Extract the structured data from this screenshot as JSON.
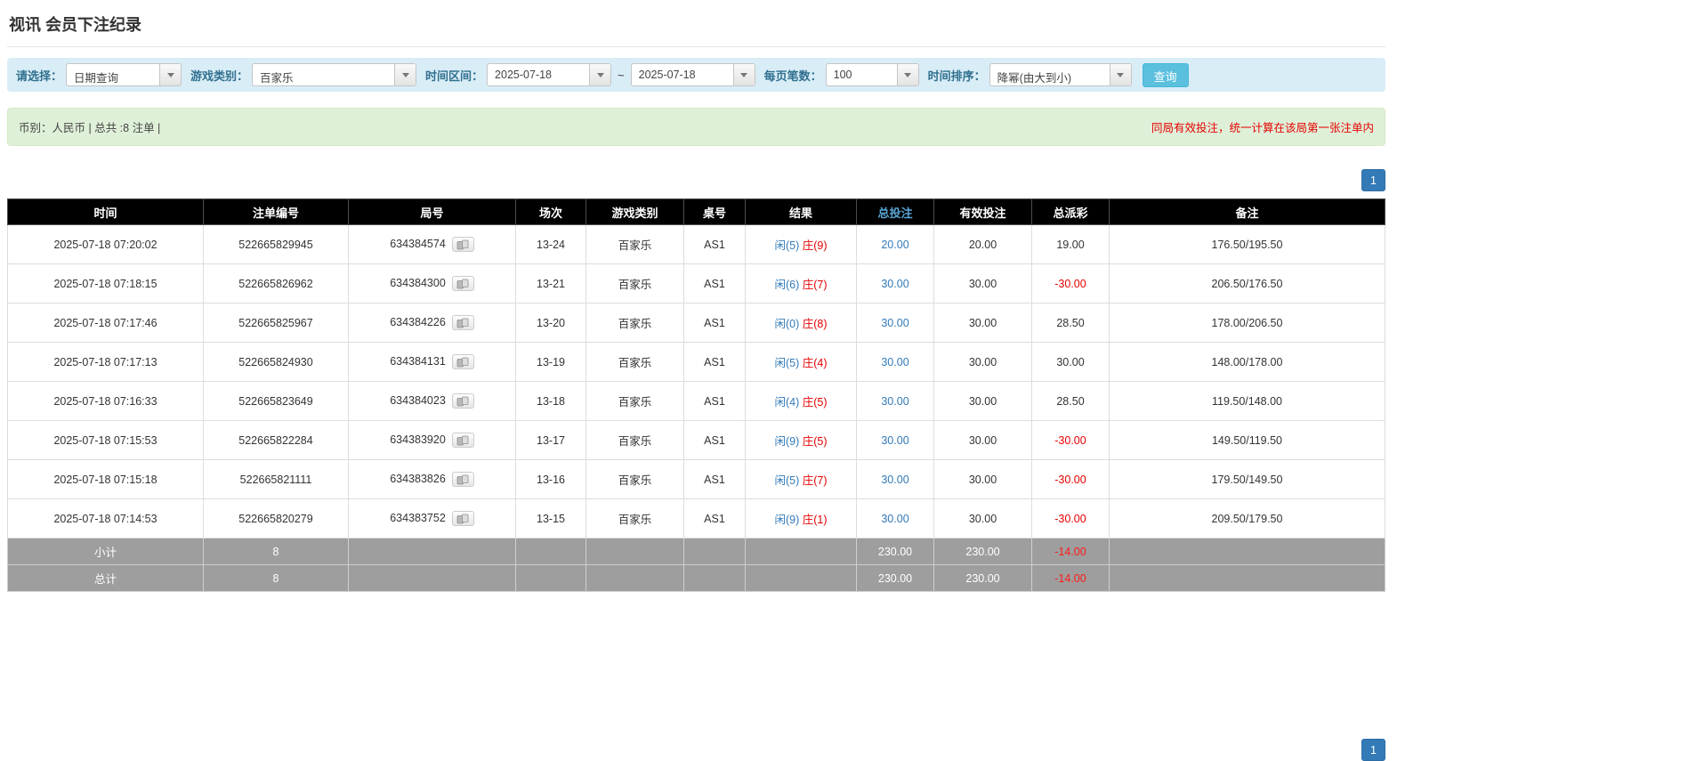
{
  "page": {
    "title": "视讯 会员下注纪录"
  },
  "filters": {
    "select_label": "请选择：",
    "select_value": "日期查询",
    "game_type_label": "游戏类别：",
    "game_type_value": "百家乐",
    "time_range_label": "时间区间：",
    "date_from": "2025-07-18",
    "date_separator": "~",
    "date_to": "2025-07-18",
    "page_size_label": "每页笔数：",
    "page_size_value": "100",
    "sort_label": "时间排序：",
    "sort_value": "降幂(由大到小)",
    "search_button": "查询"
  },
  "summary_bar": {
    "left_text": "币别：人民币 | 总共 :8 注单 |",
    "right_text": "同局有效投注，统一计算在该局第一张注单内"
  },
  "pagination": {
    "page": "1"
  },
  "table": {
    "headers": [
      "时间",
      "注单编号",
      "局号",
      "场次",
      "游戏类别",
      "桌号",
      "结果",
      "总投注",
      "有效投注",
      "总派彩",
      "备注"
    ],
    "rows": [
      {
        "time": "2025-07-18 07:20:02",
        "bet_id": "522665829945",
        "round_no": "634384574",
        "session": "13-24",
        "game": "百家乐",
        "table_no": "AS1",
        "result_player": "闲(5)",
        "result_banker": "庄(9)",
        "total_bet": "20.00",
        "valid_bet": "20.00",
        "payout": "19.00",
        "remark": "176.50/195.50"
      },
      {
        "time": "2025-07-18 07:18:15",
        "bet_id": "522665826962",
        "round_no": "634384300",
        "session": "13-21",
        "game": "百家乐",
        "table_no": "AS1",
        "result_player": "闲(6)",
        "result_banker": "庄(7)",
        "total_bet": "30.00",
        "valid_bet": "30.00",
        "payout": "-30.00",
        "remark": "206.50/176.50"
      },
      {
        "time": "2025-07-18 07:17:46",
        "bet_id": "522665825967",
        "round_no": "634384226",
        "session": "13-20",
        "game": "百家乐",
        "table_no": "AS1",
        "result_player": "闲(0)",
        "result_banker": "庄(8)",
        "total_bet": "30.00",
        "valid_bet": "30.00",
        "payout": "28.50",
        "remark": "178.00/206.50"
      },
      {
        "time": "2025-07-18 07:17:13",
        "bet_id": "522665824930",
        "round_no": "634384131",
        "session": "13-19",
        "game": "百家乐",
        "table_no": "AS1",
        "result_player": "闲(5)",
        "result_banker": "庄(4)",
        "total_bet": "30.00",
        "valid_bet": "30.00",
        "payout": "30.00",
        "remark": "148.00/178.00"
      },
      {
        "time": "2025-07-18 07:16:33",
        "bet_id": "522665823649",
        "round_no": "634384023",
        "session": "13-18",
        "game": "百家乐",
        "table_no": "AS1",
        "result_player": "闲(4)",
        "result_banker": "庄(5)",
        "total_bet": "30.00",
        "valid_bet": "30.00",
        "payout": "28.50",
        "remark": "119.50/148.00"
      },
      {
        "time": "2025-07-18 07:15:53",
        "bet_id": "522665822284",
        "round_no": "634383920",
        "session": "13-17",
        "game": "百家乐",
        "table_no": "AS1",
        "result_player": "闲(9)",
        "result_banker": "庄(5)",
        "total_bet": "30.00",
        "valid_bet": "30.00",
        "payout": "-30.00",
        "remark": "149.50/119.50"
      },
      {
        "time": "2025-07-18 07:15:18",
        "bet_id": "522665821111",
        "round_no": "634383826",
        "session": "13-16",
        "game": "百家乐",
        "table_no": "AS1",
        "result_player": "闲(5)",
        "result_banker": "庄(7)",
        "total_bet": "30.00",
        "valid_bet": "30.00",
        "payout": "-30.00",
        "remark": "179.50/149.50"
      },
      {
        "time": "2025-07-18 07:14:53",
        "bet_id": "522665820279",
        "round_no": "634383752",
        "session": "13-15",
        "game": "百家乐",
        "table_no": "AS1",
        "result_player": "闲(9)",
        "result_banker": "庄(1)",
        "total_bet": "30.00",
        "valid_bet": "30.00",
        "payout": "-30.00",
        "remark": "209.50/179.50"
      }
    ],
    "subtotal": {
      "label": "小计",
      "count": "8",
      "total_bet": "230.00",
      "valid_bet": "230.00",
      "payout": "-14.00"
    },
    "total": {
      "label": "总计",
      "count": "8",
      "total_bet": "230.00",
      "valid_bet": "230.00",
      "payout": "-14.00"
    }
  },
  "icons": {
    "select_caret": "chevron-down",
    "round_detail": "video-result-icon"
  },
  "colors": {
    "accent_blue": "#337ab7",
    "alert_red": "#e60000",
    "filter_bar_bg": "#d9edf7",
    "info_bar_bg": "#dff0d8",
    "search_button_bg": "#5bc0de",
    "table_header_bg": "#000000",
    "summary_row_bg": "#9e9e9e"
  }
}
